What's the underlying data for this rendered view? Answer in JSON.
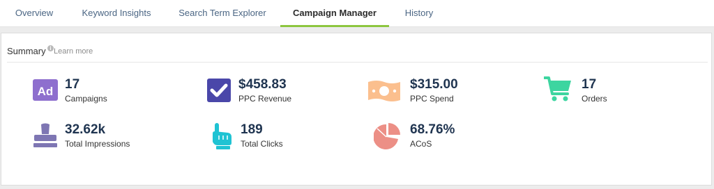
{
  "tabs": [
    {
      "label": "Overview",
      "active": false
    },
    {
      "label": "Keyword Insights",
      "active": false
    },
    {
      "label": "Search Term Explorer",
      "active": false
    },
    {
      "label": "Campaign Manager",
      "active": true
    },
    {
      "label": "History",
      "active": false
    }
  ],
  "summary": {
    "title": "Summary",
    "info_icon": "info-icon",
    "learn_more": "Learn more"
  },
  "metrics": {
    "campaigns": {
      "value": "17",
      "label": "Campaigns",
      "icon": "ad-icon",
      "color": "#8e6fce"
    },
    "ppc_revenue": {
      "value": "$458.83",
      "label": "PPC Revenue",
      "icon": "checkbox-icon",
      "color": "#4a47a9"
    },
    "ppc_spend": {
      "value": "$315.00",
      "label": "PPC Spend",
      "icon": "banknote-icon",
      "color": "#fbbf8e"
    },
    "orders": {
      "value": "17",
      "label": "Orders",
      "icon": "shopping-cart-icon",
      "color": "#3dd5a0"
    },
    "impressions": {
      "value": "32.62k",
      "label": "Total Impressions",
      "icon": "stamp-icon",
      "color": "#7e76b3"
    },
    "clicks": {
      "value": "189",
      "label": "Total Clicks",
      "icon": "pointing-hand-icon",
      "color": "#1fc3d3"
    },
    "acos": {
      "value": "68.76%",
      "label": "ACoS",
      "icon": "pie-chart-icon",
      "color": "#ec8f86"
    }
  },
  "colors": {
    "active_tab_underline": "#8dc63f",
    "tab_text": "#4a6583",
    "metric_value": "#1f3450"
  }
}
